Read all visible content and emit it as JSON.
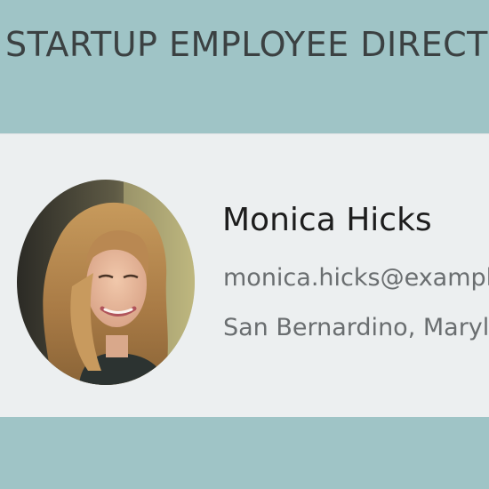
{
  "header": {
    "title": "STARTUP EMPLOYEE DIRECTORY"
  },
  "employee": {
    "name": "Monica Hicks",
    "email": "monica.hicks@example.com",
    "location": "San Bernardino, Maryland"
  },
  "colors": {
    "background": "#9fc4c6",
    "card": "#eceff0",
    "title_text": "#3b4142",
    "name_text": "#1d1d1d",
    "detail_text": "#6a6e70"
  }
}
